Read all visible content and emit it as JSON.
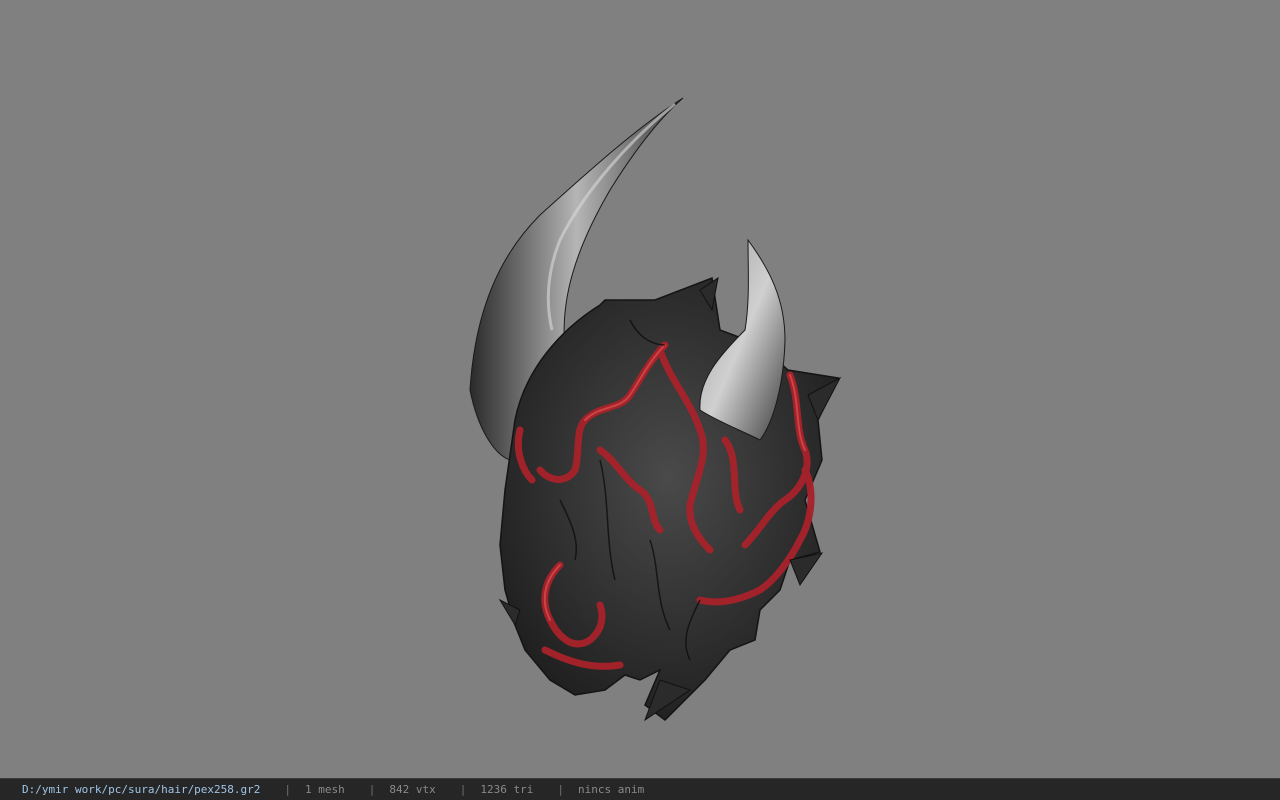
{
  "viewer": {
    "background_color": "#808080",
    "model_name": "pex258"
  },
  "status_bar": {
    "file_path": "D:/ymir work/pc/sura/hair/pex258.gr2",
    "separator": "|",
    "mesh_count": "1 mesh",
    "vertex_count": "842 vtx",
    "triangle_count": "1236 tri",
    "anim_status": "nincs anim"
  }
}
